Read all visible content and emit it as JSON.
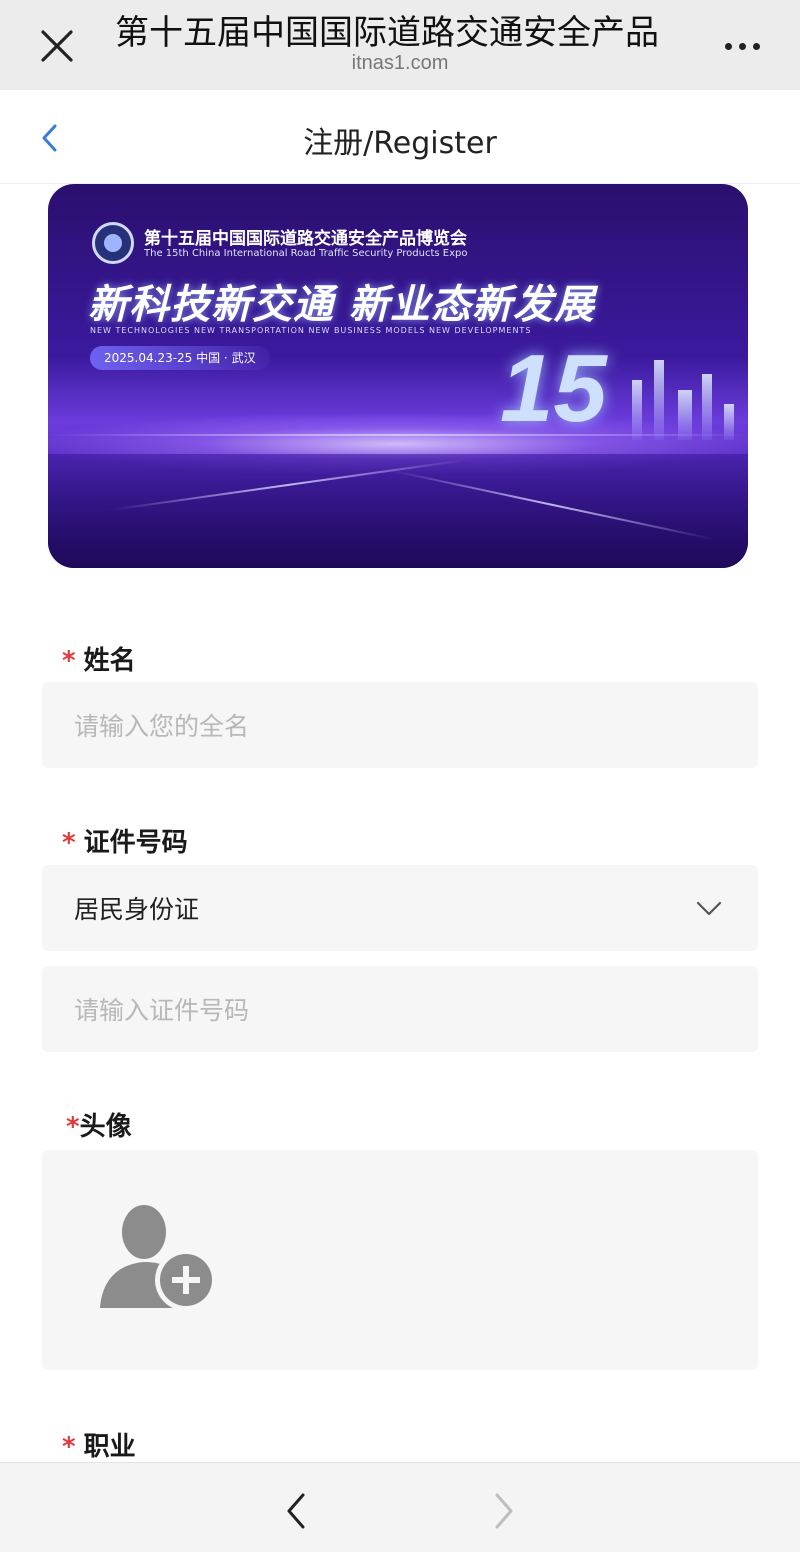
{
  "browser": {
    "title": "第十五届中国国际道路交通安全产品",
    "url": "itnas1.com",
    "close_icon": "close-icon",
    "more_icon": "more-icon"
  },
  "header": {
    "title": "注册/Register",
    "back_icon": "chevron-left-icon"
  },
  "banner": {
    "title_cn": "第十五届中国国际道路交通安全产品博览会",
    "title_en": "The 15th China International Road Traffic Security Products Expo",
    "slogan": "新科技新交通 新业态新发展",
    "slogan_en": "NEW TECHNOLOGIES NEW TRANSPORTATION NEW BUSINESS MODELS NEW DEVELOPMENTS",
    "date": "2025.04.23-25    中国 · 武汉",
    "edition": "15"
  },
  "form": {
    "required_mark": "*",
    "name": {
      "label": "姓名",
      "placeholder": "请输入您的全名"
    },
    "id": {
      "label": "证件号码",
      "type_selected": "居民身份证",
      "placeholder": "请输入证件号码"
    },
    "avatar": {
      "label": "头像",
      "upload_icon": "add-user-icon"
    },
    "occupation": {
      "label": "职业"
    }
  },
  "bottom_nav": {
    "back_icon": "chevron-left-icon",
    "forward_icon": "chevron-right-icon"
  },
  "colors": {
    "required": "#e4393c",
    "accent": "#3a7bd5",
    "banner": "#3b1a9e"
  }
}
